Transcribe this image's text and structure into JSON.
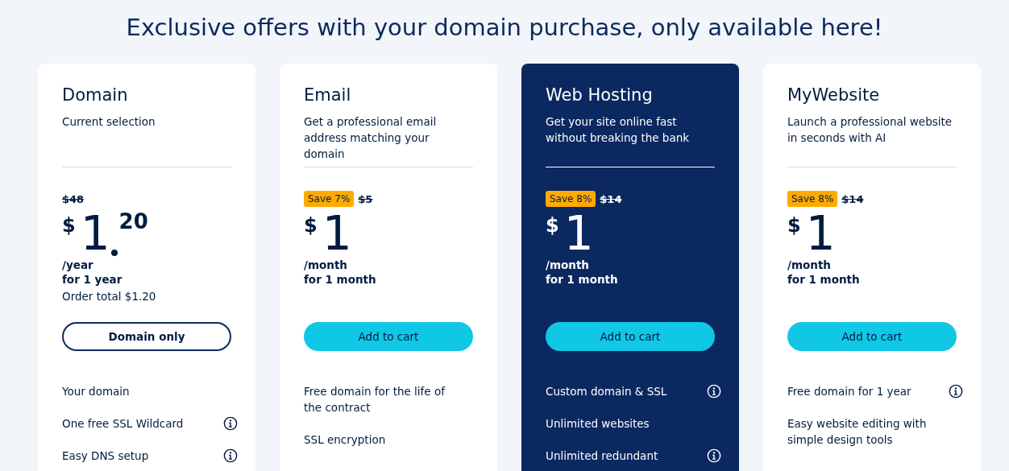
{
  "heading": "Exclusive offers with your domain purchase, only available here!",
  "plans": [
    {
      "name": "Domain",
      "subtitle": "Current selection",
      "highlighted": false,
      "old_price": "$48",
      "currency": "$",
      "price": "1",
      "cents": "20",
      "period": "/year",
      "term": "for 1 year",
      "order_total": "Order total $1.20",
      "button": {
        "label": "Domain only",
        "kind": "outline"
      },
      "features": [
        {
          "text": "Your domain",
          "info": false
        },
        {
          "text": "One free SSL Wildcard",
          "info": true
        },
        {
          "text": "Easy DNS setup",
          "info": true
        }
      ]
    },
    {
      "name": "Email",
      "subtitle": "Get a professional email address matching your domain",
      "highlighted": false,
      "save": "Save 7%",
      "old_price": "$5",
      "currency": "$",
      "price": "1",
      "period": "/month",
      "term": "for 1 month",
      "button": {
        "label": "Add to cart",
        "kind": "filled"
      },
      "features": [
        {
          "text": "Free domain for the life of the contract",
          "info": false
        },
        {
          "text": "SSL encryption",
          "info": false
        }
      ]
    },
    {
      "name": "Web Hosting",
      "subtitle": "Get your site online fast without breaking the bank",
      "highlighted": true,
      "save": "Save 8%",
      "old_price": "$14",
      "currency": "$",
      "price": "1",
      "period": "/month",
      "term": "for 1 month",
      "button": {
        "label": "Add to cart",
        "kind": "filled"
      },
      "features": [
        {
          "text": "Custom domain & SSL",
          "info": true
        },
        {
          "text": "Unlimited websites",
          "info": false
        },
        {
          "text": "Unlimited redundant",
          "info": true
        }
      ]
    },
    {
      "name": "MyWebsite",
      "subtitle": "Launch a professional website in seconds with AI",
      "highlighted": false,
      "save": "Save 8%",
      "old_price": "$14",
      "currency": "$",
      "price": "1",
      "period": "/month",
      "term": "for 1 month",
      "button": {
        "label": "Add to cart",
        "kind": "filled"
      },
      "features": [
        {
          "text": "Free domain for 1 year",
          "info": true
        },
        {
          "text": "Easy website editing with simple design tools",
          "info": false
        }
      ]
    }
  ]
}
